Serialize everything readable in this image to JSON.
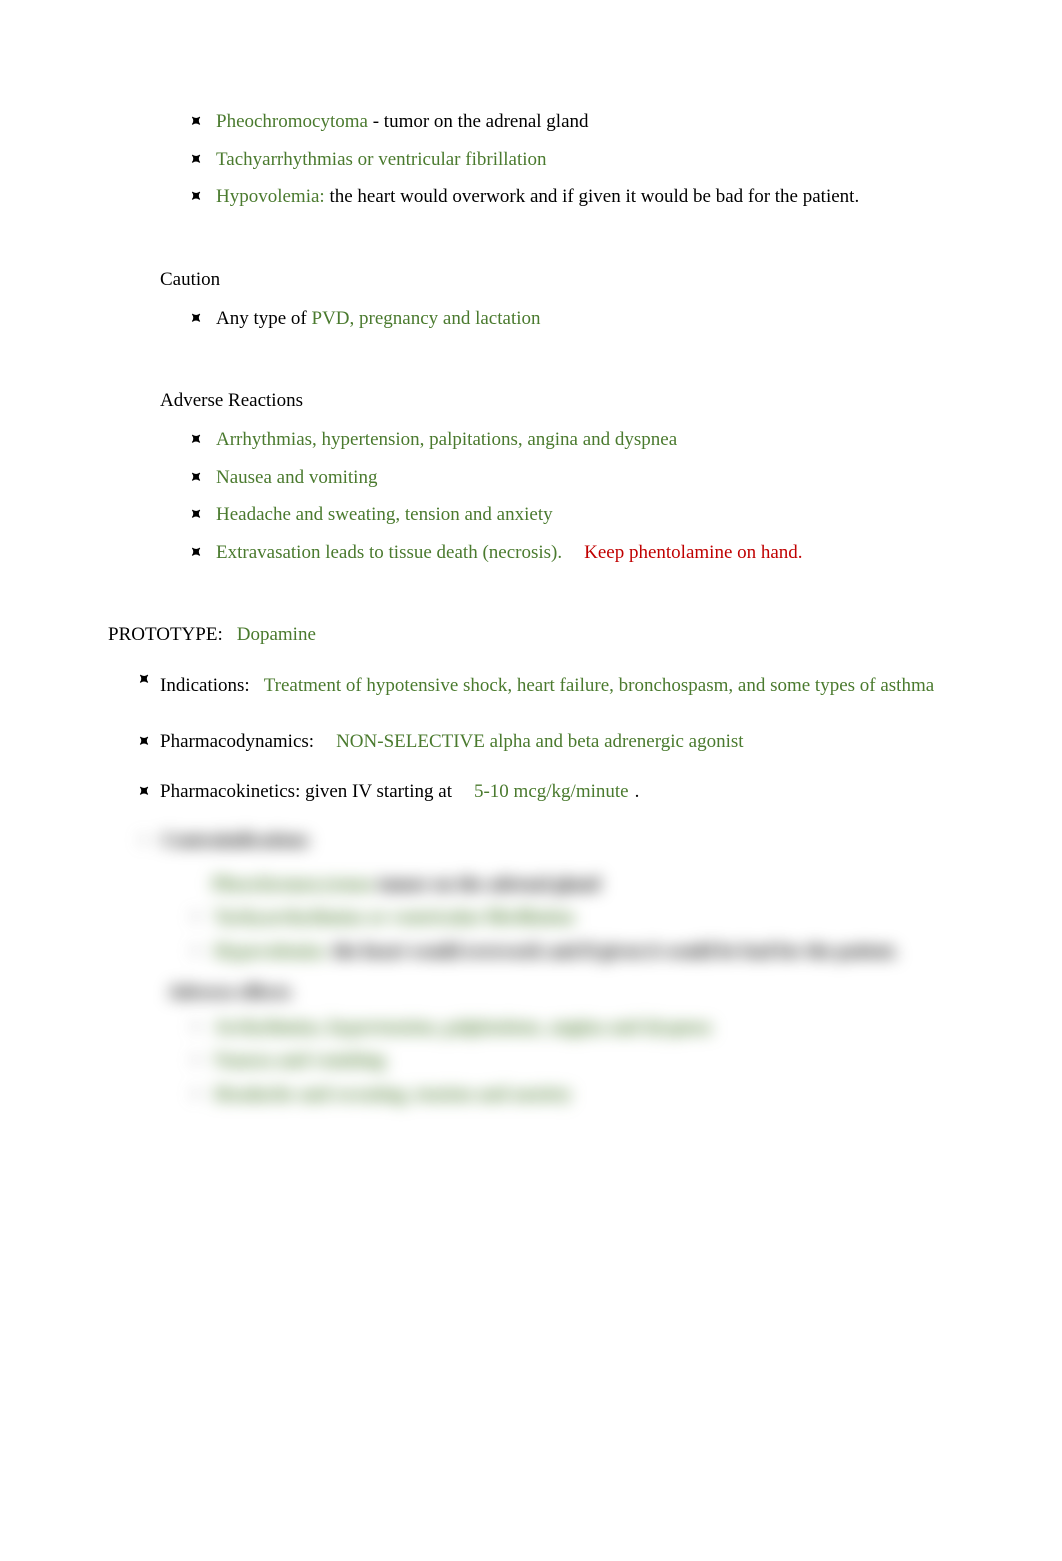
{
  "top_bullets": [
    {
      "green": "Pheochromocytoma",
      "black": " - tumor on the adrenal gland"
    },
    {
      "green": "Tachyarrhythmias or ventricular fibrillation",
      "black": ""
    },
    {
      "green": "Hypovolemia:",
      "black": "  the heart would overwork and if given it would be bad for the patient."
    }
  ],
  "caution_heading": "Caution",
  "caution_bullet": {
    "black_prefix": "Any type of ",
    "green": "PVD, pregnancy and lactation"
  },
  "adverse_heading": "Adverse Reactions",
  "adverse_bullets": [
    {
      "green": "Arrhythmias, hypertension, palpitations, angina and dyspnea",
      "red": ""
    },
    {
      "green": "Nausea and vomiting",
      "red": ""
    },
    {
      "green": "Headache and sweating, tension and anxiety",
      "red": ""
    },
    {
      "green": "Extravasation leads to tissue death (necrosis).",
      "red": "Keep phentolamine on hand."
    }
  ],
  "prototype": {
    "label": "PROTOTYPE:",
    "name": "Dopamine"
  },
  "prototype_bullets": {
    "indications": {
      "label": "Indications:",
      "value": "Treatment of hypotensive shock, heart failure, bronchospasm, and some types of asthma"
    },
    "pharmacodynamics": {
      "label": "Pharmacodynamics:",
      "value": "NON-SELECTIVE alpha and beta adrenergic agonist"
    },
    "pharmacokinetics": {
      "label": "Pharmacokinetics: given IV starting at",
      "value": "5-10 mcg/kg/minute",
      "suffix": "."
    }
  },
  "blurred": {
    "contra_heading": "Contraindications",
    "contra_bullets": [
      {
        "green": "Pheochromocytoma",
        "black": " tumor on the adrenal gland"
      },
      {
        "green": "Tachyarrhythmias or ventricular fibrillation",
        "black": ""
      },
      {
        "green": "Hypovolemia:",
        "black": " the heart would overwork and if given it would be bad for the patient."
      }
    ],
    "adverse_heading": "Adverse effects",
    "adverse_bullets": [
      {
        "green": "Arrhythmias, hypertension, palpitations, angina and dyspnea"
      },
      {
        "green": "Nausea and vomiting"
      },
      {
        "green": "Headache and sweating, tension and anxiety"
      }
    ]
  }
}
